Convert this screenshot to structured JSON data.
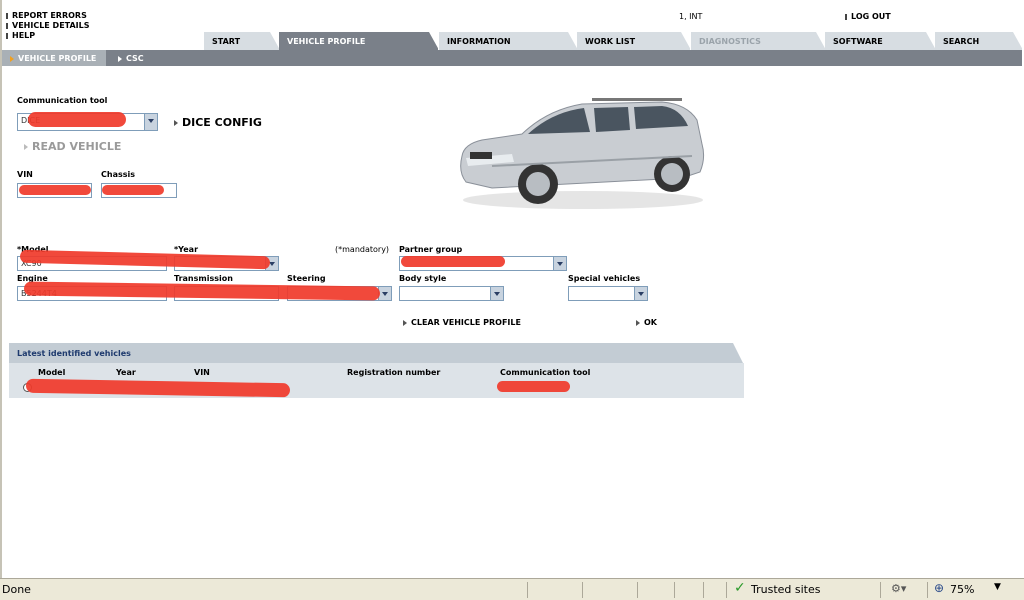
{
  "top_links": [
    "REPORT ERRORS",
    "VEHICLE DETAILS",
    "HELP"
  ],
  "user_info": "1, INT",
  "logout_label": "LOG OUT",
  "tabs": [
    {
      "label": "START",
      "state": "normal"
    },
    {
      "label": "VEHICLE PROFILE",
      "state": "active"
    },
    {
      "label": "INFORMATION",
      "state": "normal"
    },
    {
      "label": "WORK LIST",
      "state": "normal"
    },
    {
      "label": "DIAGNOSTICS",
      "state": "disabled"
    },
    {
      "label": "SOFTWARE",
      "state": "normal"
    },
    {
      "label": "SEARCH",
      "state": "normal"
    }
  ],
  "subtabs": [
    "VEHICLE PROFILE",
    "CSC"
  ],
  "form": {
    "comm_tool_label": "Communication tool",
    "comm_tool_value": "DICE",
    "dice_config_label": "DICE CONFIG",
    "read_vehicle_label": "READ VEHICLE",
    "vin_label": "VIN",
    "chassis_label": "Chassis",
    "model_label": "*Model",
    "model_value": "XC90",
    "year_label": "*Year",
    "mandatory_note": "(*mandatory)",
    "partner_group_label": "Partner group",
    "engine_label": "Engine",
    "engine_value": "B5244T4",
    "transmission_label": "Transmission",
    "steering_label": "Steering",
    "body_style_label": "Body style",
    "special_vehicles_label": "Special vehicles",
    "clear_label": "CLEAR VEHICLE PROFILE",
    "ok_label": "OK"
  },
  "latest": {
    "title": "Latest identified vehicles",
    "columns": [
      "Model",
      "Year",
      "VIN",
      "Registration number",
      "Communication tool"
    ]
  },
  "statusbar": {
    "status": "Done",
    "zone": "Trusted sites",
    "zoom": "75%"
  },
  "colors": {
    "tab_active": "#7a8089",
    "tab_inactive": "#d7dde2",
    "redaction": "#f03a2a",
    "panel": "#dde3e8"
  }
}
